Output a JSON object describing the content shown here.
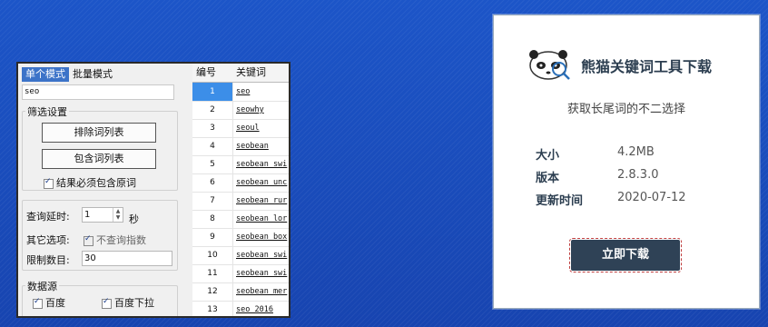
{
  "app": {
    "tabs": [
      "单个模式",
      "批量模式"
    ],
    "seo_value": "seo",
    "filter_title": "筛选设置",
    "exclude_button": "排除词列表",
    "include_button": "包含词列表",
    "must_contain_label": "结果必须包含原词",
    "delay_label": "查询延时:",
    "delay_value": "1",
    "delay_unit": "秒",
    "other_label": "其它选项:",
    "no_index_label": "不查询指数",
    "limit_label": "限制数目:",
    "limit_value": "30",
    "source_title": "数据源",
    "source_baidu": "百度",
    "source_baidu_dropdown": "百度下拉"
  },
  "grid": {
    "headers": [
      "编号",
      "关键词"
    ],
    "rows": [
      {
        "num": "1",
        "kw": "seo"
      },
      {
        "num": "2",
        "kw": "seowhy"
      },
      {
        "num": "3",
        "kw": "seoul"
      },
      {
        "num": "4",
        "kw": "seobean"
      },
      {
        "num": "5",
        "kw": "seobean swi"
      },
      {
        "num": "6",
        "kw": "seobean unc"
      },
      {
        "num": "7",
        "kw": "seobean rur"
      },
      {
        "num": "8",
        "kw": "seobean lor"
      },
      {
        "num": "9",
        "kw": "seobean box"
      },
      {
        "num": "10",
        "kw": "seobean swi"
      },
      {
        "num": "11",
        "kw": "seobean swi"
      },
      {
        "num": "12",
        "kw": "seobean mer"
      },
      {
        "num": "13",
        "kw": "seo 2016"
      }
    ]
  },
  "card": {
    "title": "熊猫关键词工具下载",
    "tagline": "获取长尾词的不二选择",
    "size_label": "大小",
    "size_value": "4.2MB",
    "version_label": "版本",
    "version_value": "2.8.3.0",
    "updated_label": "更新时间",
    "updated_value": "2020-07-12",
    "download_button": "立即下载",
    "logo_icon": "panda-icon"
  },
  "colors": {
    "background": "#1848b8",
    "button": "#2f4256",
    "selected_row": "#3c8ee8"
  }
}
